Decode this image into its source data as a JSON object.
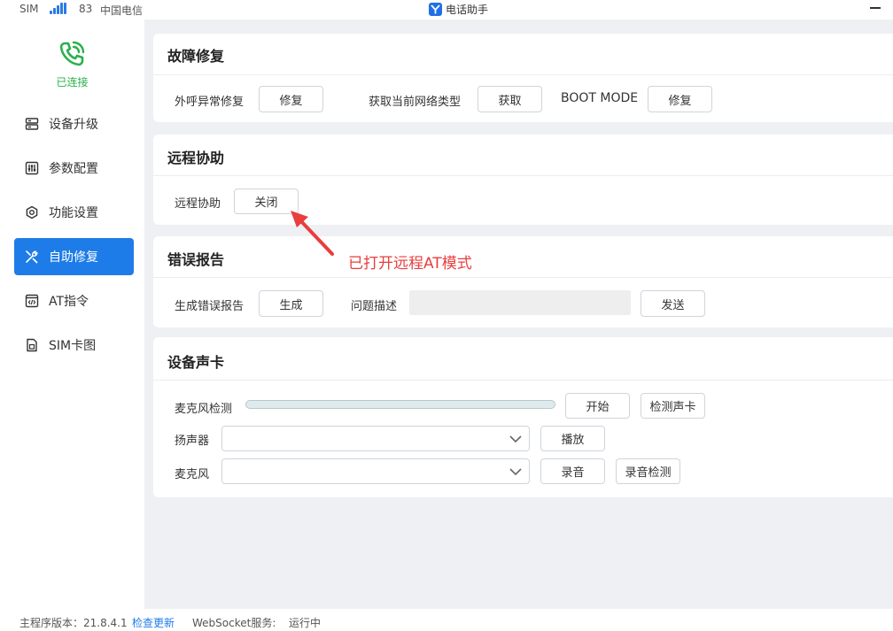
{
  "topbar": {
    "sim_label": "SIM",
    "signal_value": "83",
    "carrier": "中国电信",
    "app_title": "电话助手"
  },
  "sidebar": {
    "status": "已连接",
    "items": [
      {
        "label": "设备升级",
        "icon": "server-icon"
      },
      {
        "label": "参数配置",
        "icon": "sliders-icon"
      },
      {
        "label": "功能设置",
        "icon": "gear-icon"
      },
      {
        "label": "自助修复",
        "icon": "tools-icon",
        "active": true
      },
      {
        "label": "AT指令",
        "icon": "code-icon"
      },
      {
        "label": "SIM卡图",
        "icon": "sim-card-icon"
      }
    ]
  },
  "sections": {
    "repair": {
      "title": "故障修复",
      "outcall_label": "外呼异常修复",
      "outcall_button": "修复",
      "network_label": "获取当前网络类型",
      "network_button": "获取",
      "boot_label": "BOOT MODE",
      "boot_button": "修复"
    },
    "remote": {
      "title": "远程协助",
      "label": "远程协助",
      "button": "关闭"
    },
    "error_report": {
      "title": "错误报告",
      "generate_label": "生成错误报告",
      "generate_button": "生成",
      "desc_label": "问题描述",
      "desc_value": "",
      "send_button": "发送"
    },
    "sound_card": {
      "title": "设备声卡",
      "mic_test_label": "麦克风检测",
      "mic_level": 0,
      "start_button": "开始",
      "detect_button": "检测声卡",
      "speaker_label": "扬声器",
      "speaker_value": "",
      "play_button": "播放",
      "mic_label": "麦克风",
      "mic_value": "",
      "record_button": "录音",
      "record_test_button": "录音检测"
    }
  },
  "annotation": {
    "text": "已打开远程AT模式",
    "color": "#e83e3e"
  },
  "statusbar": {
    "version_label": "主程序版本：21.8.4.1",
    "check_update": "检查更新",
    "websocket_label": "WebSocket服务:",
    "websocket_status": "运行中"
  },
  "colors": {
    "accent": "#1e7ce8",
    "connected": "#29b04c",
    "background": "#eef0f3"
  }
}
